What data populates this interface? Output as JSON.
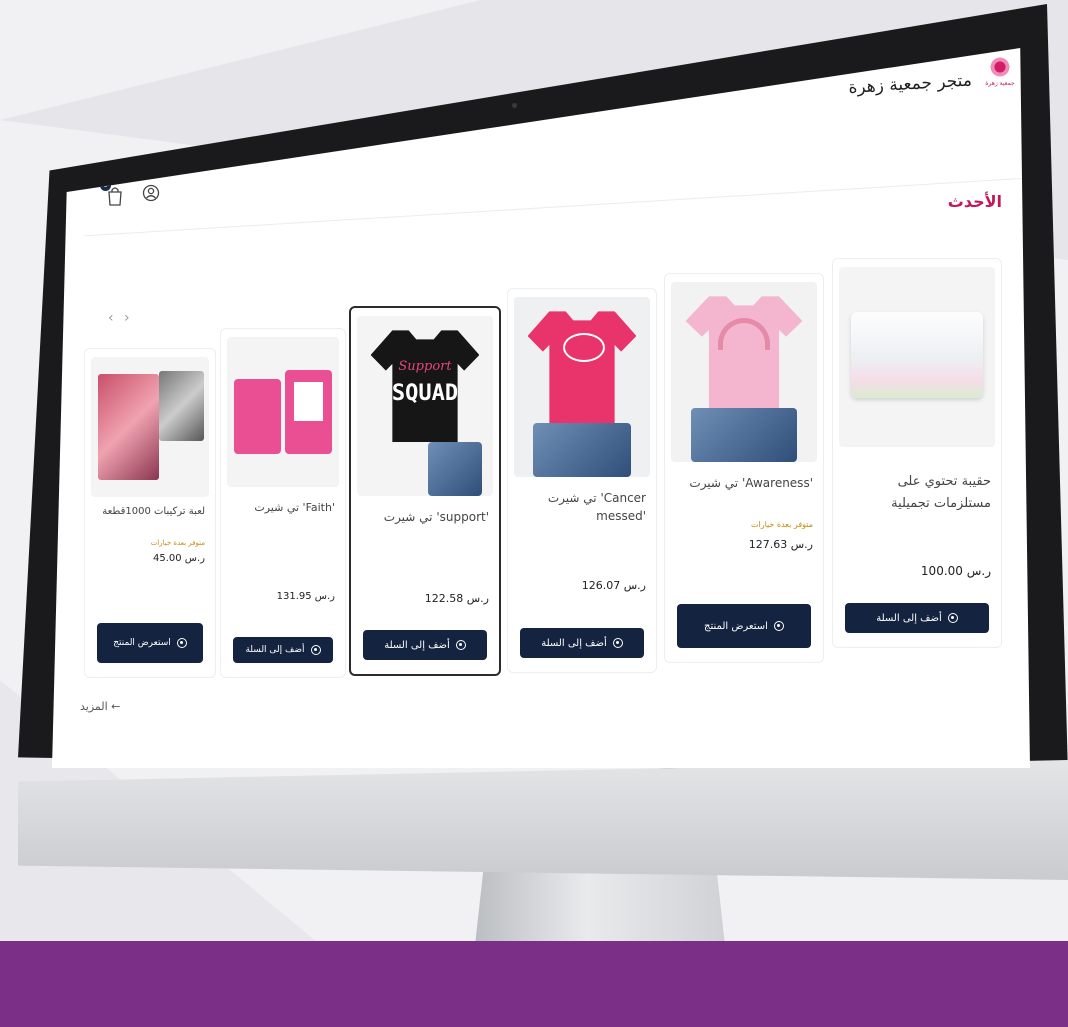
{
  "store": {
    "title": "متجر جمعية زهرة",
    "logo_text": "جمعية زهرة",
    "cart_count": "0"
  },
  "section": {
    "title": "الأحدث",
    "more_link": "المزيد ←"
  },
  "products": [
    {
      "name": "حقيبة تحتوي على مستلزمات تجميلية",
      "availability": "",
      "price": "100.00 ر.س",
      "button": "أضف إلى السلة"
    },
    {
      "name": "تي شيرت 'Awareness'",
      "availability": "متوفر بعدة خيارات",
      "price": "127.63 ر.س",
      "button": "استعرض المنتج"
    },
    {
      "name": "تي شيرت 'Cancer messed'",
      "availability": "",
      "price": "126.07 ر.س",
      "button": "أضف إلى السلة"
    },
    {
      "name": "تي شيرت 'support'",
      "availability": "",
      "price": "122.58 ر.س",
      "button": "أضف إلى السلة"
    },
    {
      "name": "تي شيرت 'Faith'",
      "availability": "",
      "price": "131.95 ر.س",
      "button": "أضف إلى السلة"
    },
    {
      "name": "لعبة تركيبات 1000قطعة",
      "availability": "متوفر بعدة خيارات",
      "price": "45.00 ر.س",
      "button": "استعرض المنتج"
    }
  ],
  "shirt_art": {
    "support_line1": "Support",
    "support_line2": "SQUAD"
  },
  "colors": {
    "brand_pink": "#c2185b",
    "button_navy": "#14233f",
    "footer_purple": "#7b2f86"
  }
}
